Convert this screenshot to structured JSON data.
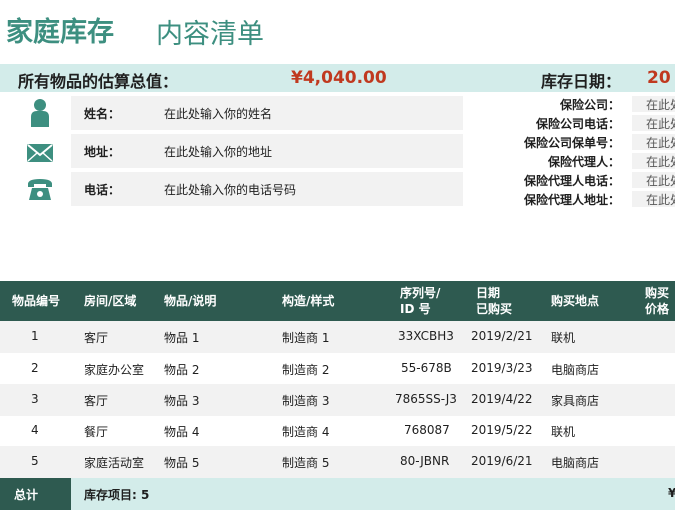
{
  "header": {
    "title": "家庭库存",
    "subtitle": "内容清单"
  },
  "summary": {
    "total_label": "所有物品的估算总值：",
    "total_value": "¥4,040.00",
    "date_label": "库存日期：",
    "date_value": "20"
  },
  "contact": [
    {
      "icon": "person-icon",
      "label": "姓名：",
      "value": "在此处输入你的姓名"
    },
    {
      "icon": "envelope-icon",
      "label": "地址：",
      "value": "在此处输入你的地址"
    },
    {
      "icon": "telephone-icon",
      "label": "电话：",
      "value": "在此处输入你的电话号码"
    }
  ],
  "insurance": [
    {
      "label": "保险公司：",
      "value": "在此处"
    },
    {
      "label": "保险公司电话：",
      "value": "在此处"
    },
    {
      "label": "保险公司保单号：",
      "value": "在此处"
    },
    {
      "label": "保险代理人：",
      "value": "在此处"
    },
    {
      "label": "保险代理人电话：",
      "value": "在此处"
    },
    {
      "label": "保险代理人地址：",
      "value": "在此处"
    }
  ],
  "table": {
    "headers": [
      {
        "line1": "物品编号",
        "line2": ""
      },
      {
        "line1": "房间/区域",
        "line2": ""
      },
      {
        "line1": "物品/说明",
        "line2": ""
      },
      {
        "line1": "构造/样式",
        "line2": ""
      },
      {
        "line1": "序列号/",
        "line2": "ID 号"
      },
      {
        "line1": "日期",
        "line2": "已购买"
      },
      {
        "line1": "购买地点",
        "line2": ""
      },
      {
        "line1": "购买",
        "line2": "价格"
      }
    ],
    "rows": [
      {
        "id": "1",
        "room": "客厅",
        "item": "物品 1",
        "make": "制造商 1",
        "serial": "33XCBH3",
        "date": "2019/2/21",
        "place": "联机"
      },
      {
        "id": "2",
        "room": "家庭办公室",
        "item": "物品 2",
        "make": "制造商 2",
        "serial": "55-678B",
        "date": "2019/3/23",
        "place": "电脑商店"
      },
      {
        "id": "3",
        "room": "客厅",
        "item": "物品 3",
        "make": "制造商 3",
        "serial": "7865SS-J3",
        "date": "2019/4/22",
        "place": "家具商店"
      },
      {
        "id": "4",
        "room": "餐厅",
        "item": "物品 4",
        "make": "制造商 4",
        "serial": "768087",
        "date": "2019/5/22",
        "place": "联机"
      },
      {
        "id": "5",
        "room": "家庭活动室",
        "item": "物品 5",
        "make": "制造商 5",
        "serial": "80-JBNR",
        "date": "2019/6/21",
        "place": "电脑商店"
      }
    ]
  },
  "footer": {
    "total_label": "总计",
    "count_label": "库存项目: 5",
    "right_fragment": "¥"
  }
}
